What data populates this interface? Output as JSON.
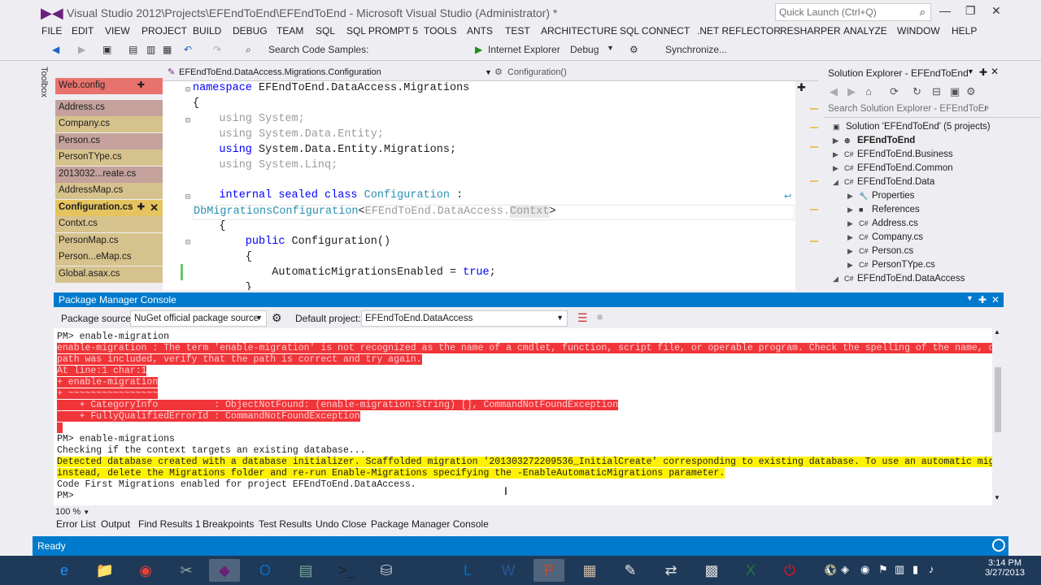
{
  "window": {
    "title": "Visual Studio 2012\\Projects\\EFEndToEnd\\EFEndToEnd - Microsoft Visual Studio (Administrator) *",
    "quick_launch": "Quick Launch (Ctrl+Q)"
  },
  "menu": [
    "FILE",
    "EDIT",
    "VIEW",
    "PROJECT",
    "BUILD",
    "DEBUG",
    "TEAM",
    "SQL",
    "SQL PROMPT 5",
    "TOOLS",
    "ANTS",
    "TEST",
    "ARCHITECTURE",
    "SQL CONNECT",
    ".NET REFLECTOR",
    "RESHARPER",
    "ANALYZE",
    "WINDOW",
    "HELP"
  ],
  "toolbar": {
    "search_samples": "Search Code Samples:",
    "browser": "Internet Explorer",
    "config": "Debug",
    "sync": "Synchronize..."
  },
  "toolbox_label": "Toolbox",
  "files": [
    {
      "name": "Web.config",
      "style": "red"
    },
    {
      "name": "Address.cs",
      "style": "gray"
    },
    {
      "name": "Company.cs",
      "style": "orange"
    },
    {
      "name": "Person.cs",
      "style": "gray"
    },
    {
      "name": "PersonTYpe.cs",
      "style": "orange"
    },
    {
      "name": "2013032...reate.cs",
      "style": "gray"
    },
    {
      "name": "AddressMap.cs",
      "style": "orange"
    },
    {
      "name": "Configuration.cs",
      "style": "active"
    },
    {
      "name": "Contxt.cs",
      "style": "orange"
    },
    {
      "name": "PersonMap.cs",
      "style": "orange"
    },
    {
      "name": "Person...eMap.cs",
      "style": "orange"
    },
    {
      "name": "Global.asax.cs",
      "style": "orange"
    }
  ],
  "nav": {
    "left": "EFEndToEnd.DataAccess.Migrations.Configuration",
    "right": "Configuration()"
  },
  "code": {
    "l1_kw": "namespace",
    "l1_rest": " EFEndToEnd.DataAccess.Migrations",
    "l2": "{",
    "l3": "    using System;",
    "l4": "    using System.Data.Entity;",
    "l5_kw": "    using",
    "l5_rest": " System.Data.Entity.Migrations;",
    "l6": "    using System.Linq;",
    "l7_kw": "    internal sealed class",
    "l7_ty": " Configuration",
    "l7_rest": " :",
    "l8_ty": "DbMigrationsConfiguration",
    "l8_a": "<",
    "l8_b": "EFEndToEnd.DataAccess.",
    "l8_c": "Contxt",
    "l8_d": ">",
    "l9": "    {",
    "l10_kw": "        public",
    "l10_rest": " Configuration()",
    "l11": "        {",
    "l12_a": "            AutomaticMigrationsEnabled = ",
    "l12_kw": "true",
    "l12_b": ";",
    "l13": "        }"
  },
  "solution_explorer": {
    "title": "Solution Explorer - EFEndToEnd",
    "search": "Search Solution Explorer - EFEndToEr",
    "items": [
      {
        "label": "Solution 'EFEndToEnd' (5 projects)",
        "indent": 0,
        "arrow": "",
        "icon": "▣"
      },
      {
        "label": "EFEndToEnd",
        "indent": 0,
        "arrow": "▶",
        "icon": "⊕",
        "bold": true
      },
      {
        "label": "EFEndToEnd.Business",
        "indent": 0,
        "arrow": "▶",
        "icon": "C#"
      },
      {
        "label": "EFEndToEnd.Common",
        "indent": 0,
        "arrow": "▶",
        "icon": "C#"
      },
      {
        "label": "EFEndToEnd.Data",
        "indent": 0,
        "arrow": "◢",
        "icon": "C#"
      },
      {
        "label": "Properties",
        "indent": 1,
        "arrow": "▶",
        "icon": "🔧"
      },
      {
        "label": "References",
        "indent": 1,
        "arrow": "▶",
        "icon": "■"
      },
      {
        "label": "Address.cs",
        "indent": 1,
        "arrow": "▶",
        "icon": "C#"
      },
      {
        "label": "Company.cs",
        "indent": 1,
        "arrow": "▶",
        "icon": "C#"
      },
      {
        "label": "Person.cs",
        "indent": 1,
        "arrow": "▶",
        "icon": "C#"
      },
      {
        "label": "PersonTYpe.cs",
        "indent": 1,
        "arrow": "▶",
        "icon": "C#"
      },
      {
        "label": "EFEndToEnd.DataAccess",
        "indent": 0,
        "arrow": "◢",
        "icon": "C#"
      }
    ]
  },
  "pmc": {
    "title": "Package Manager Console",
    "source_label": "Package source:",
    "source_value": "NuGet official package source",
    "project_label": "Default project:",
    "project_value": "EFEndToEnd.DataAccess"
  },
  "console_lines": [
    {
      "text": "PM> enable-migration",
      "style": ""
    },
    {
      "text": "enable-migration : The term 'enable-migration' is not recognized as the name of a cmdlet, function, script file, or operable program. Check the spelling of the name, or if a",
      "style": "err"
    },
    {
      "text": "path was included, verify that the path is correct and try again.",
      "style": "err"
    },
    {
      "text": "At line:1 char:1",
      "style": "err"
    },
    {
      "text": "+ enable-migration",
      "style": "err"
    },
    {
      "text": "+ ~~~~~~~~~~~~~~~~",
      "style": "err"
    },
    {
      "text": "    + CategoryInfo          : ObjectNotFound: (enable-migration:String) [], CommandNotFoundException",
      "style": "err"
    },
    {
      "text": "    + FullyQualifiedErrorId : CommandNotFoundException",
      "style": "err"
    },
    {
      "text": " ",
      "style": "err"
    },
    {
      "text": "PM> enable-migrations",
      "style": ""
    },
    {
      "text": "Checking if the context targets an existing database...",
      "style": ""
    },
    {
      "text": "Detected database created with a database initializer. Scaffolded migration '201303272209536_InitialCreate' corresponding to existing database. To use an automatic migration",
      "style": "warn"
    },
    {
      "text": "instead, delete the Migrations folder and re-run Enable-Migrations specifying the -EnableAutomaticMigrations parameter.",
      "style": "warn"
    },
    {
      "text": "Code First Migrations enabled for project EFEndToEnd.DataAccess.",
      "style": ""
    },
    {
      "text": "PM>",
      "style": ""
    }
  ],
  "zoom": "100 %",
  "bottom_tabs": [
    "Error List",
    "Output",
    "Find Results 1",
    "Breakpoints",
    "Test Results",
    "Undo Close",
    "Package Manager Console"
  ],
  "status": "Ready",
  "clock": {
    "time": "3:14 PM",
    "date": "3/27/2013"
  },
  "taskbar_icons": [
    {
      "name": "internet-explorer-icon",
      "glyph": "e",
      "color": "#1e90ff"
    },
    {
      "name": "file-explorer-icon",
      "glyph": "📁",
      "color": "#f5c542"
    },
    {
      "name": "chrome-icon",
      "glyph": "◉",
      "color": "#e34133"
    },
    {
      "name": "tools-icon",
      "glyph": "✂",
      "color": "#9aa"
    },
    {
      "name": "visual-studio-icon",
      "glyph": "◆",
      "color": "#68217a"
    },
    {
      "name": "outlook-icon",
      "glyph": "O",
      "color": "#0072c6"
    },
    {
      "name": "app-icon",
      "glyph": "▤",
      "color": "#7a9"
    },
    {
      "name": "console-icon",
      "glyph": ">_",
      "color": "#222"
    },
    {
      "name": "database-icon",
      "glyph": "⛁",
      "color": "#ccc"
    },
    {
      "name": "lync-icon",
      "glyph": "L",
      "color": "#0072c6"
    },
    {
      "name": "word-icon",
      "glyph": "W",
      "color": "#2b579a"
    },
    {
      "name": "powerpoint-icon",
      "glyph": "P",
      "color": "#d24726"
    },
    {
      "name": "app2-icon",
      "glyph": "▦",
      "color": "#cba"
    },
    {
      "name": "paint-icon",
      "glyph": "✎",
      "color": "#eee"
    },
    {
      "name": "network-icon",
      "glyph": "⇄",
      "color": "#ddd"
    },
    {
      "name": "calculator-icon",
      "glyph": "▩",
      "color": "#ddd"
    },
    {
      "name": "excel-icon",
      "glyph": "X",
      "color": "#217346"
    },
    {
      "name": "power-icon",
      "glyph": "⏻",
      "color": "#e81123"
    },
    {
      "name": "app3-icon",
      "glyph": "✪",
      "color": "#aa8"
    }
  ]
}
